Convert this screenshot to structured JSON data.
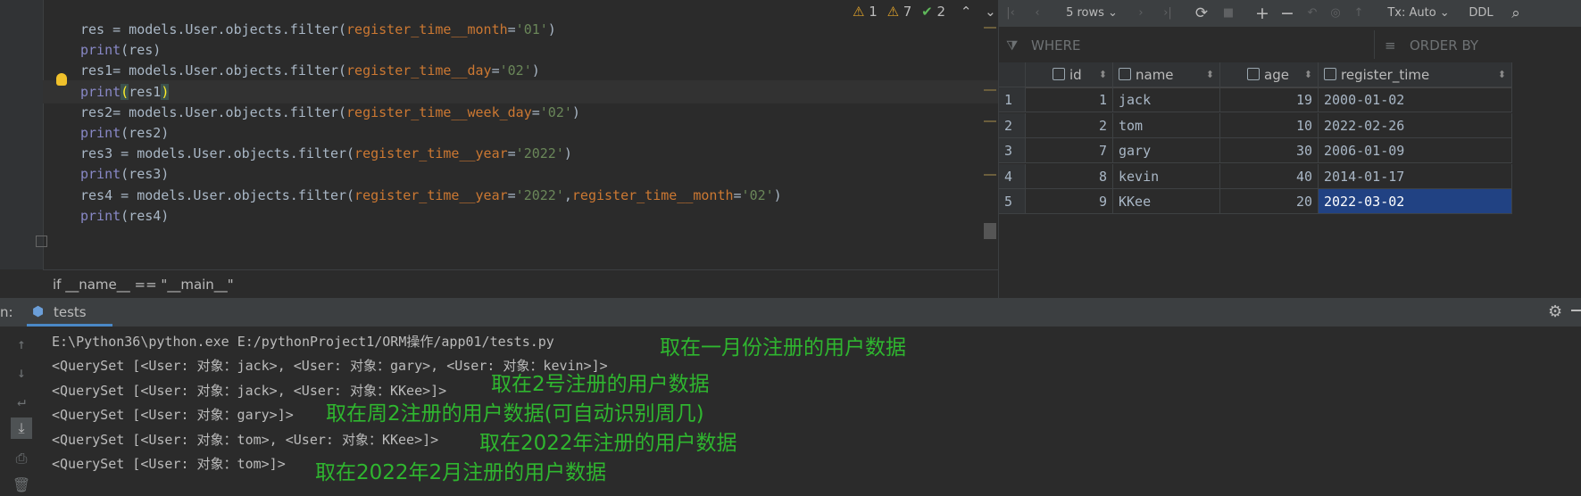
{
  "editor": {
    "lines": [
      {
        "parts": [
          [
            "plain",
            "res = models.User.objects.filter("
          ],
          [
            "param",
            "register_time__month"
          ],
          [
            "plain",
            "="
          ],
          [
            "str",
            "'01'"
          ],
          [
            "plain",
            ")"
          ]
        ]
      },
      {
        "parts": [
          [
            "fn",
            "print"
          ],
          [
            "plain",
            "(res)"
          ]
        ]
      },
      {
        "parts": [
          [
            "plain",
            "res1= models.User.objects.filter("
          ],
          [
            "param",
            "register_time__day"
          ],
          [
            "plain",
            "="
          ],
          [
            "str",
            "'02'"
          ],
          [
            "plain",
            ")"
          ]
        ]
      },
      {
        "parts": [
          [
            "fn",
            "print"
          ],
          [
            "hl",
            "("
          ],
          [
            "plain",
            "res1"
          ],
          [
            "hl",
            ")"
          ]
        ]
      },
      {
        "parts": [
          [
            "plain",
            "res2= models.User.objects.filter("
          ],
          [
            "param",
            "register_time__week_day"
          ],
          [
            "plain",
            "="
          ],
          [
            "str",
            "'02'"
          ],
          [
            "plain",
            ")"
          ]
        ]
      },
      {
        "parts": [
          [
            "fn",
            "print"
          ],
          [
            "plain",
            "(res2)"
          ]
        ]
      },
      {
        "parts": [
          [
            "plain",
            "res3 = models.User.objects.filter("
          ],
          [
            "param",
            "register_time__year"
          ],
          [
            "plain",
            "="
          ],
          [
            "str",
            "'2022'"
          ],
          [
            "plain",
            ")"
          ]
        ]
      },
      {
        "parts": [
          [
            "fn",
            "print"
          ],
          [
            "plain",
            "(res3)"
          ]
        ]
      },
      {
        "parts": [
          [
            "plain",
            "res4 = models.User.objects.filter("
          ],
          [
            "param",
            "register_time__year"
          ],
          [
            "plain",
            "="
          ],
          [
            "str",
            "'2022'"
          ],
          [
            "plain",
            ","
          ],
          [
            "param",
            "register_time__month"
          ],
          [
            "plain",
            "="
          ],
          [
            "str",
            "'02'"
          ],
          [
            "plain",
            ")"
          ]
        ]
      },
      {
        "parts": [
          [
            "fn",
            "print"
          ],
          [
            "plain",
            "(res4)"
          ]
        ]
      }
    ],
    "inspections": {
      "warnings_a": "1",
      "warnings_b": "7",
      "ok": "2"
    },
    "breadcrumb": "if __name__ == \"__main__\""
  },
  "db": {
    "rows_label": "5 rows",
    "tx_label": "Tx: Auto",
    "ddl_label": "DDL",
    "where_placeholder": "WHERE",
    "orderby_placeholder": "ORDER BY",
    "columns": [
      "id",
      "name",
      "age",
      "register_time"
    ],
    "rows": [
      {
        "n": "1",
        "id": "1",
        "name": "jack",
        "age": "19",
        "register_time": "2000-01-02"
      },
      {
        "n": "2",
        "id": "2",
        "name": "tom",
        "age": "10",
        "register_time": "2022-02-26"
      },
      {
        "n": "3",
        "id": "7",
        "name": "gary",
        "age": "30",
        "register_time": "2006-01-09"
      },
      {
        "n": "4",
        "id": "8",
        "name": "kevin",
        "age": "40",
        "register_time": "2014-01-17"
      },
      {
        "n": "5",
        "id": "9",
        "name": "KKee",
        "age": "20",
        "register_time": "2022-03-02"
      }
    ],
    "selected_cell": {
      "row": 4,
      "column": "register_time"
    }
  },
  "run": {
    "prefix": "n:",
    "tab_label": "tests",
    "console_lines": [
      "E:\\Python36\\python.exe E:/pythonProject1/ORM操作/app01/tests.py",
      "<QuerySet [<User: 对象：jack>, <User: 对象：gary>, <User: 对象：kevin>]>",
      "<QuerySet [<User: 对象：jack>, <User: 对象：KKee>]>",
      "<QuerySet [<User: 对象：gary>]>",
      "<QuerySet [<User: 对象：tom>, <User: 对象：KKee>]>",
      "<QuerySet [<User: 对象：tom>]>"
    ],
    "notes": [
      "取在一月份注册的用户数据",
      "取在2号注册的用户数据",
      "取在周2注册的用户数据(可自动识别周几)",
      "取在2022年注册的用户数据",
      "取在2022年2月注册的用户数据"
    ]
  },
  "colors": {
    "annotation": "#2fb62f",
    "selection": "#214283",
    "string": "#6a8759",
    "param": "#cc7832",
    "builtin": "#8888c6"
  }
}
